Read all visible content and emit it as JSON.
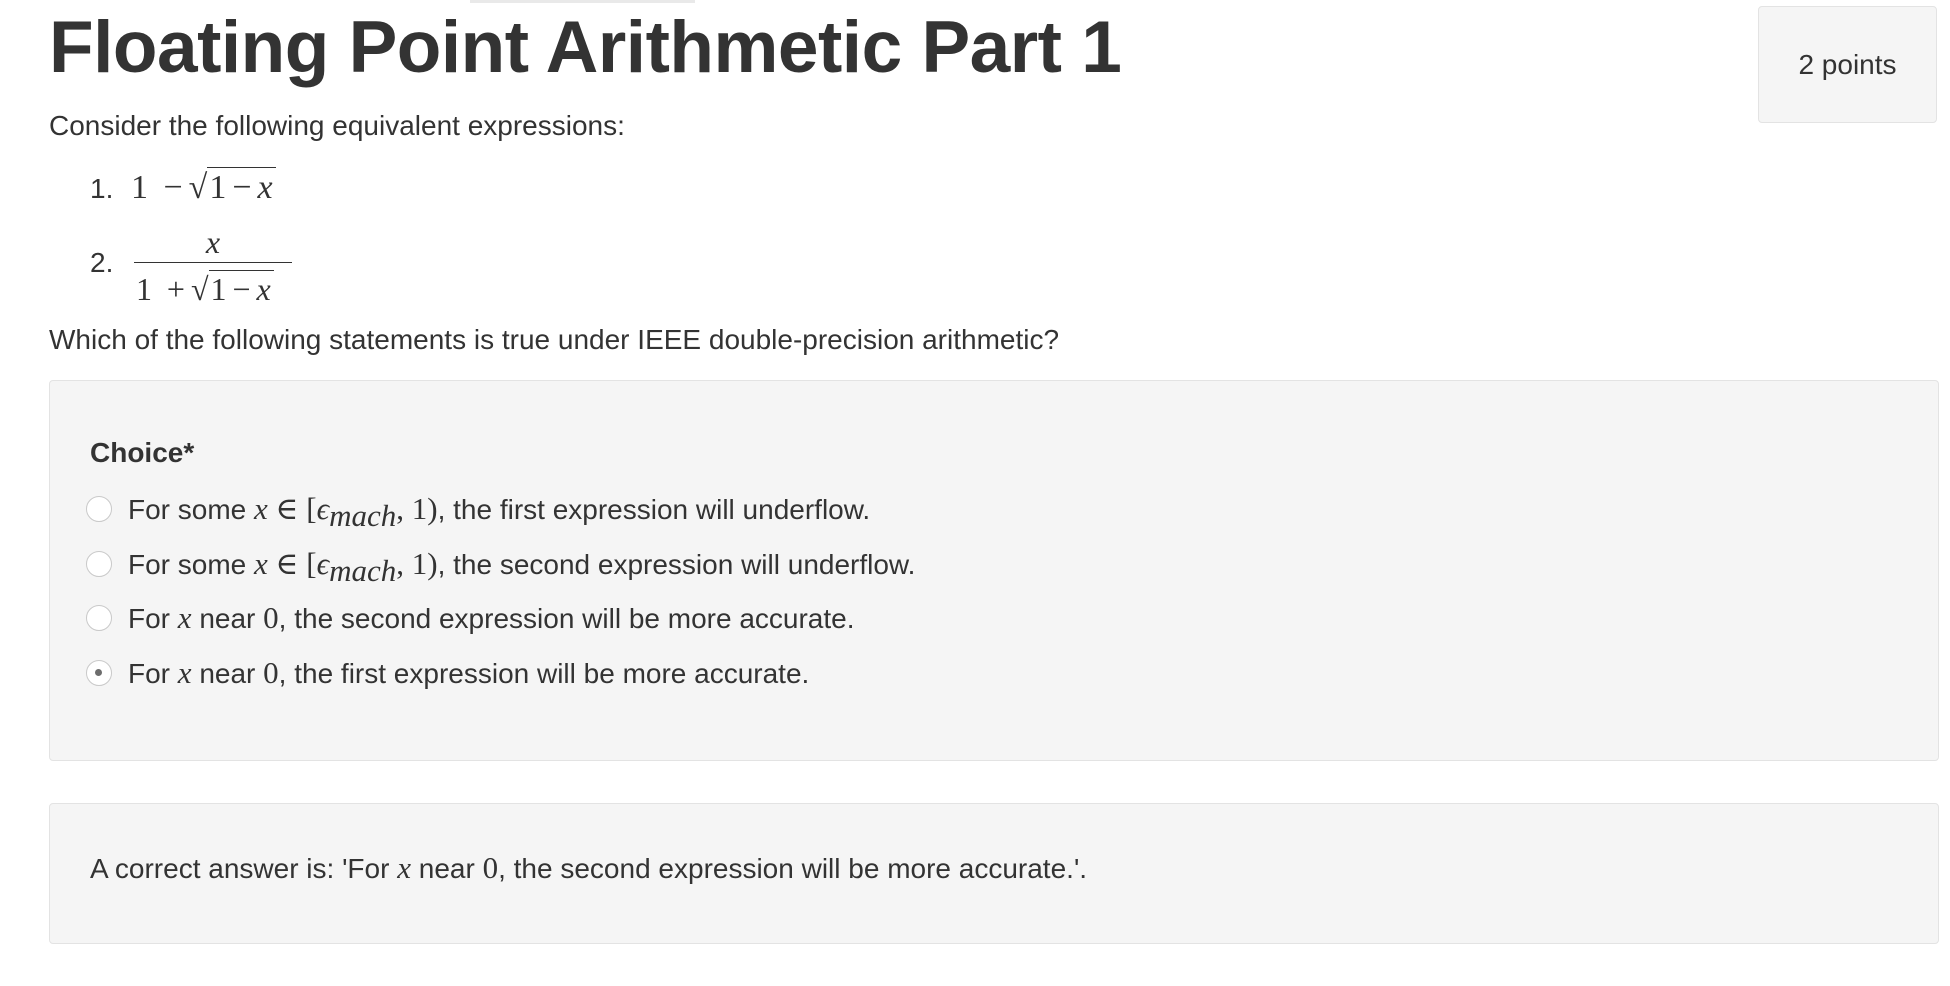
{
  "page": {
    "title": "Floating Point Arithmetic Part 1",
    "points": "2 points"
  },
  "prompt": {
    "intro": "Consider the following equivalent expressions:",
    "question": "Which of the following statements is true under IEEE double-precision arithmetic?"
  },
  "expressions": [
    {
      "number": "1.",
      "leading": "1",
      "operator": "−",
      "radicand_one": "1",
      "radicand_op": "−",
      "radicand_var": "x"
    },
    {
      "number": "2.",
      "numerator": "x",
      "den_one": "1",
      "den_op": "+",
      "radicand_one": "1",
      "radicand_op": "−",
      "radicand_var": "x"
    }
  ],
  "choice": {
    "label": "Choice*",
    "selected_index": 3,
    "options": [
      {
        "prefix": "For some ",
        "var": "x",
        "rel": " ∈ [",
        "eps": "ϵ",
        "eps_sub": "mach",
        "interval_rest": ", 1)",
        "suffix": ", the first expression will underflow."
      },
      {
        "prefix": "For some ",
        "var": "x",
        "rel": " ∈ [",
        "eps": "ϵ",
        "eps_sub": "mach",
        "interval_rest": ", 1)",
        "suffix": ", the second expression will underflow."
      },
      {
        "prefix": "For ",
        "var": "x",
        "middle": " near ",
        "zero": "0",
        "suffix": ", the second expression will be more accurate."
      },
      {
        "prefix": "For ",
        "var": "x",
        "middle": " near ",
        "zero": "0",
        "suffix": ", the first expression will be more accurate."
      }
    ]
  },
  "answer": {
    "prefix": "A correct answer is: 'For ",
    "var": "x",
    "middle": " near ",
    "zero": "0",
    "suffix": ", the second expression will be more accurate.'."
  },
  "colors": {
    "text": "#333333",
    "panel_bg": "#f5f5f5",
    "panel_border": "#e3e3e3"
  }
}
